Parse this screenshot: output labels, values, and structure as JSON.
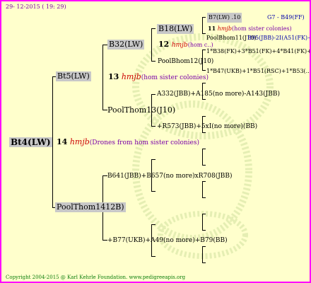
{
  "header": {
    "date": "29- 12-2015 ( 19: 29)"
  },
  "footer": {
    "copyright": "Copyright 2004-2015 @ Karl Kehrle Foundation.   www.pedigreeapis.org"
  },
  "root": {
    "label": "Bt4(LW)"
  },
  "gen1": {
    "mid_num": "14",
    "mid_hm": "hmjb",
    "mid_note": "(Drones from hom sister colonies)",
    "upper": "Bt5(LW)",
    "lower": "PoolThom1412B)"
  },
  "gen2": {
    "upper_mid_num": "13",
    "upper_mid_hm": "hmjb",
    "upper_mid_note": "(hom sister colonies)",
    "b32": "B32(LW)",
    "poolthom13": "PoolThom13(J10)",
    "b641": "B641(JBB)+B657(no more)xR708(JBB)",
    "b77": "+B77(UKB)+A49(no more)+B79(BB)"
  },
  "gen3": {
    "b18": "B18(LW)",
    "n12": "12",
    "n12_hm": "hmjb",
    "n12_note": "(hom c..)",
    "poolbhom12": "PoolBhom12(J10)",
    "a332": "A332(JBB)+A185(no more)-A143(JBB)",
    "r573": "+R573(JBB)+5xI(no more)(BB)"
  },
  "gen4": {
    "b7": "B7(LW) .10",
    "g7": "G7 - B49(FF)",
    "n11": "11",
    "n11_hm": "hmjb",
    "n11_note": "(hom sister colonies)",
    "poolbhom11": "PoolBhom11(J10)",
    "b95": "B95(JBB)-2I(A51(FK)+5",
    "b38": "1*B38(FK)+3*B51(FK)+4*B41(FK)+2*...",
    "b47": "1*B47(UKB)+1*B51(RSC)+1*B53(..."
  }
}
